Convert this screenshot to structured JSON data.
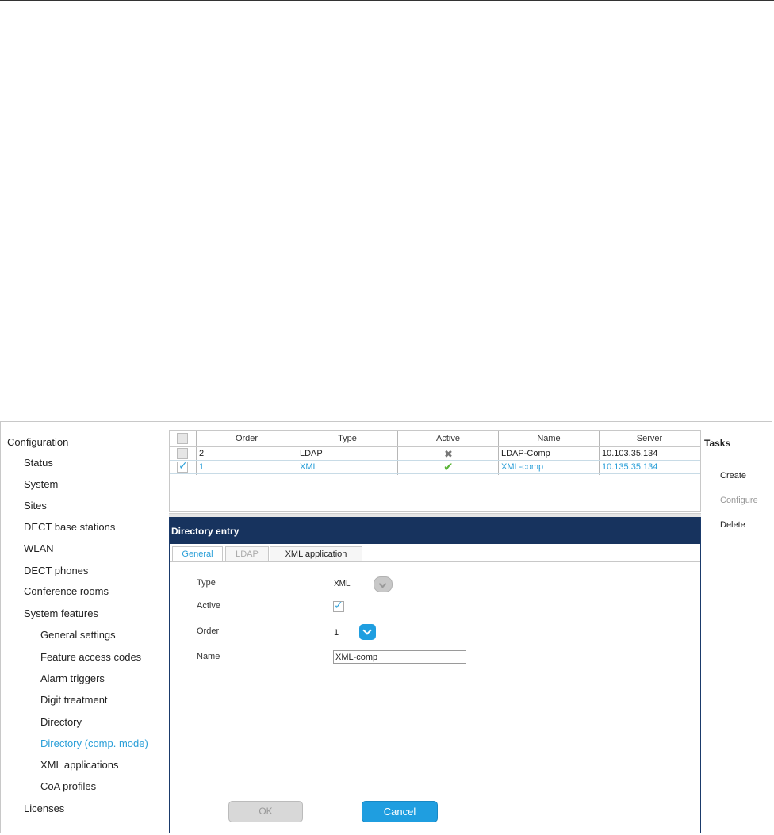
{
  "sidebar": {
    "root": "Configuration",
    "items": [
      "Status",
      "System",
      "Sites",
      "DECT base stations",
      "WLAN",
      "DECT phones",
      "Conference rooms",
      "System features"
    ],
    "sub_items": [
      "General settings",
      "Feature access codes",
      "Alarm triggers",
      "Digit treatment",
      "Directory",
      "Directory (comp. mode)",
      "XML applications",
      "CoA profiles"
    ],
    "last_item": "Licenses",
    "active_item": "Directory (comp. mode)"
  },
  "grid": {
    "columns": [
      "Order",
      "Type",
      "Active",
      "Name",
      "Server"
    ],
    "rows": [
      {
        "order": "2",
        "type": "LDAP",
        "active": "✖",
        "name": "LDAP-Comp",
        "server": "10.103.35.134",
        "checked": false
      },
      {
        "order": "1",
        "type": "XML",
        "active": "✔",
        "name": "XML-comp",
        "server": "10.135.35.134",
        "checked": true
      }
    ]
  },
  "panel": {
    "title": "Directory entry",
    "tabs": [
      "General",
      "LDAP",
      "XML application"
    ],
    "labels": {
      "type": "Type",
      "active": "Active",
      "order": "Order",
      "name": "Name"
    },
    "values": {
      "type": "XML",
      "order": "1",
      "name": "XML-comp"
    },
    "ok_label": "OK",
    "cancel_label": "Cancel"
  },
  "tasks": {
    "title": "Tasks",
    "create": "Create",
    "configure": "Configure",
    "delete": "Delete"
  },
  "colors": {
    "accent": "#2a9fd8",
    "header": "#17335e",
    "ok_mark": "#59b435"
  }
}
